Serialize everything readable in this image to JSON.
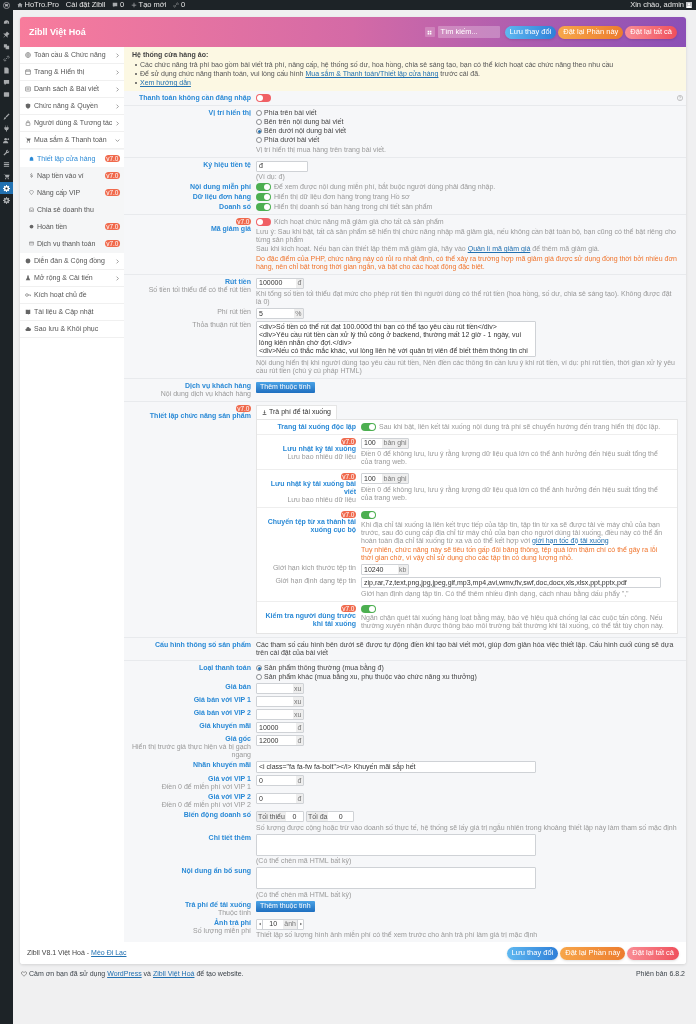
{
  "admin_bar": {
    "items": [
      {
        "kind": "logo"
      },
      {
        "kind": "home",
        "label": "HoTro.Pro"
      },
      {
        "kind": "plain",
        "label": "Cài đặt Zibll"
      },
      {
        "kind": "comments",
        "label": "0"
      },
      {
        "kind": "new",
        "label": "Tạo mới"
      },
      {
        "kind": "links",
        "label": "0"
      }
    ],
    "greeting": "Xin chào, admin"
  },
  "wp_menu": [
    {
      "selected": false
    },
    {
      "selected": false
    },
    {
      "selected": false
    },
    {
      "selected": false
    },
    {
      "selected": false
    },
    {
      "selected": false
    },
    {
      "selected": false
    },
    {
      "selected": false
    },
    {
      "selected": false
    },
    {
      "selected": false
    },
    {
      "selected": false
    },
    {
      "selected": false
    },
    {
      "selected": false
    },
    {
      "selected": true
    },
    {
      "selected": false
    }
  ],
  "header": {
    "title": "Zibll Việt Hoá",
    "search": {
      "placeholder": "Tìm kiếm..."
    },
    "buttons": [
      {
        "kind": "save",
        "label": "Lưu thay đổi"
      },
      {
        "kind": "reset_section",
        "label": "Đặt lại Phần này"
      },
      {
        "kind": "reset_all",
        "label": "Đặt lại tất cả"
      }
    ]
  },
  "sidebar": {
    "items": [
      {
        "label": "Toàn cầu & Chức năng",
        "expanded": false
      },
      {
        "label": "Trang & Hiển thị",
        "expanded": false
      },
      {
        "label": "Danh sách & Bài viết",
        "expanded": false
      },
      {
        "label": "Chức năng & Quyền",
        "expanded": false
      },
      {
        "label": "Người dùng & Tương tác",
        "expanded": false
      },
      {
        "label": "Mua sắm & Thanh toán",
        "expanded": true,
        "children": [
          {
            "label": "Thiết lập cửa hàng",
            "selected": true,
            "badge": "v7.0"
          },
          {
            "label": "Nạp tiền vào ví",
            "selected": false,
            "badge": "v7.0"
          },
          {
            "label": "Nâng cấp VIP",
            "selected": false,
            "badge": "v7.0"
          },
          {
            "label": "Chia sẻ doanh thu",
            "selected": false
          },
          {
            "label": "Hoàn tiền",
            "selected": false,
            "badge": "v7.0"
          },
          {
            "label": "Dịch vụ thanh toán",
            "selected": false,
            "badge": "v7.0"
          }
        ]
      },
      {
        "label": "Diễn đàn & Cộng đồng",
        "expanded": false
      },
      {
        "label": "Mở rộng & Cải tiến",
        "expanded": false
      },
      {
        "label": "Kích hoạt chủ đề"
      },
      {
        "label": "Tài liệu & Cập nhật"
      },
      {
        "label": "Sao lưu & Khôi phục"
      }
    ]
  },
  "notice": {
    "title": "Hệ thống cửa hàng ảo:",
    "items": [
      {
        "parts": [
          {
            "kind": "text",
            "text": "Các chức năng trả phí bao gồm bài viết trả phí, nâng cấp, hệ thống số dư, hoa hồng, chia sẻ sáng tạo, bạn có thể kích hoạt các chức năng theo nhu cầu"
          }
        ]
      },
      {
        "parts": [
          {
            "kind": "text",
            "text": "Để sử dụng chức năng thanh toán, vui lòng cấu hình "
          },
          {
            "kind": "link",
            "text": "Mua sắm & Thanh toán/Thiết lập cửa hàng"
          },
          {
            "kind": "text",
            "text": " trước cái đã."
          }
        ]
      },
      {
        "parts": [
          {
            "kind": "link",
            "text": "Xem hướng dẫn"
          }
        ]
      }
    ]
  },
  "sections": [
    {
      "rows": [
        {
          "label": "Thanh toán không cần đăng nhập",
          "items": [
            {
              "kind": "toggle",
              "on": false
            }
          ]
        }
      ]
    },
    {
      "rows": [
        {
          "label": "Vị trí hiển thị",
          "items": [
            {
              "kind": "radio_group",
              "options": [
                {
                  "label": "Phía trên bài viết",
                  "selected": false
                },
                {
                  "label": "Bên trên nội dung bài viết",
                  "selected": false
                },
                {
                  "label": "Bên dưới nội dung bài viết",
                  "selected": true
                },
                {
                  "label": "Phía dưới bài viết",
                  "selected": false
                }
              ]
            },
            {
              "kind": "hint",
              "parts": [
                {
                  "kind": "text",
                  "text": "Vị trí hiển thị mua hàng trên trang bài viết."
                }
              ]
            }
          ]
        }
      ]
    },
    {
      "rows": [
        {
          "label": "Ký hiệu tiền tệ",
          "items": [
            {
              "kind": "input",
              "value": "đ"
            },
            {
              "kind": "hint",
              "parts": [
                {
                  "kind": "text",
                  "text": "(Ví dụ: đ)"
                }
              ]
            }
          ]
        },
        {
          "label": "Nội dung miễn phí",
          "items": [
            {
              "kind": "toggle",
              "on": true,
              "text": "Để xem được nội dung miễn phí, bắt buộc người dùng phải đăng nhập."
            }
          ]
        },
        {
          "label": "Dữ liệu đơn hàng",
          "items": [
            {
              "kind": "toggle",
              "on": true,
              "text": "Hiển thị dữ liệu đơn hàng trong trang Hồ sơ"
            }
          ]
        },
        {
          "label": "Doanh số",
          "items": [
            {
              "kind": "toggle",
              "on": true,
              "text": "Hiển thị doanh số bán hàng trong chi tiết sản phẩm"
            }
          ]
        }
      ]
    },
    {
      "rows": [
        {
          "label": "Mã giảm giá",
          "badge": "v7.0",
          "items": [
            {
              "kind": "toggle",
              "on": false,
              "text": "Kích hoạt chức năng mã giảm giá cho tất cả sản phẩm"
            },
            {
              "kind": "hint",
              "parts": [
                {
                  "kind": "text",
                  "text": "Lưu ý: Sau khi bật, tất cả sản phẩm sẽ hiển thị chức năng nhập mã giảm giá, nếu không cần bật toàn bộ, bạn cũng có thể bật riêng cho từng sản phẩm"
                }
              ]
            },
            {
              "kind": "hint",
              "parts": [
                {
                  "kind": "text",
                  "text": "Sau khi kích hoạt. Nếu bạn cần thiết lập thêm mã giảm giá, hãy vào "
                },
                {
                  "kind": "link",
                  "text": "Quản lí mã giảm giá"
                },
                {
                  "kind": "text",
                  "text": " để thêm mã giảm giá."
                }
              ]
            },
            {
              "kind": "warning",
              "parts": [
                {
                  "kind": "text",
                  "text": "Do đặc điểm của PHP, chức năng này có rủi ro nhất định, có thể xảy ra trường hợp mã giảm giá được sử dụng đồng thời bởi nhiều đơn hàng, nên chỉ bật trong thời gian ngắn, và bật cho các hoạt động đặc biệt."
                }
              ]
            }
          ]
        }
      ]
    },
    {
      "rows": [
        {
          "label": "Rút tiền",
          "sublabel": "Số tiền tối thiểu để có thể rút tiền",
          "items": [
            {
              "kind": "input",
              "value": "100000",
              "unit": "đ"
            },
            {
              "kind": "hint",
              "parts": [
                {
                  "kind": "text",
                  "text": "Khi tổng số tiền tối thiểu đạt mức cho phép rút tiền thì người dùng có thể rút tiền (hoa hồng, số dư, chia sẻ sáng tạo). Không được đặt là 0)"
                }
              ]
            }
          ],
          "subfields": [
            {
              "label": "Phí rút tiền",
              "items": [
                {
                  "kind": "input",
                  "value": "5",
                  "unit": "%"
                }
              ]
            },
            {
              "label": "Thỏa thuận rút tiền",
              "items": [
                {
                  "kind": "textarea",
                  "value": "<div>Số tiền có thể rút đạt 100.000đ thì bạn có thể tạo yêu cầu rút tiền</div>\n<div>Yêu cầu rút tiền cần xử lý thủ công ở backend, thường mất 12 giờ - 1 ngày, vui lòng kiên nhẫn chờ đợi.</div>\n<div>Nếu có thắc mắc khác, vui lòng liên hệ với quản trị viên để biết thêm thông tin chi"
                },
                {
                  "kind": "hint",
                  "parts": [
                    {
                      "kind": "text",
                      "text": "Nội dung hiển thị khi người dùng tạo yêu cầu rút tiền, Nên điền các thông tin cần lưu ý khi rút tiền, ví dụ: phí rút tiền, thời gian xử lý yêu cầu rút tiền (chú ý cú pháp HTML)"
                    }
                  ]
                }
              ]
            }
          ]
        }
      ]
    },
    {
      "rows": [
        {
          "label": "Dịch vụ khách hàng",
          "sublabel": "Nội dung dịch vụ khách hàng",
          "items": [
            {
              "kind": "button",
              "label": "Thêm thuộc tính"
            }
          ]
        }
      ]
    },
    {
      "rows": [
        {
          "label": "Thiết lập chức năng sản phẩm",
          "badge": "v7.0",
          "items": [
            {
              "kind": "tabs",
              "tabs": [
                {
                  "label": "Trả phí để tải xuống",
                  "selected": true
                }
              ],
              "groups": [
                {
                  "rows": [
                    {
                      "label": "Trang tải xuống độc lập",
                      "items": [
                        {
                          "kind": "toggle",
                          "on": true,
                          "text": "Sau khi bật, liên kết tải xuống nội dung trả phí sẽ chuyển hướng đến trang hiển thị độc lập."
                        }
                      ]
                    }
                  ]
                },
                {
                  "rows": [
                    {
                      "label": "Lưu nhật ký tải xuống",
                      "badge": "v7.0",
                      "sublabel": "Lưu bao nhiêu dữ liệu",
                      "items": [
                        {
                          "kind": "input",
                          "value": "100",
                          "unit": "bản ghi"
                        },
                        {
                          "kind": "hint",
                          "parts": [
                            {
                              "kind": "text",
                              "text": "Điền 0 để không lưu, lưu ý rằng lượng dữ liệu quá lớn có thể ảnh hưởng đến hiệu suất tổng thể của trang web."
                            }
                          ]
                        }
                      ]
                    }
                  ]
                },
                {
                  "rows": [
                    {
                      "label": "Lưu nhật ký tải xuống bài viết",
                      "badge": "v7.0",
                      "sublabel": "Lưu bao nhiêu dữ liệu",
                      "items": [
                        {
                          "kind": "input",
                          "value": "100",
                          "unit": "bản ghi"
                        },
                        {
                          "kind": "hint",
                          "parts": [
                            {
                              "kind": "text",
                              "text": "Điền 0 để không lưu, lưu ý rằng lượng dữ liệu quá lớn có thể ảnh hưởng đến hiệu suất tổng thể của trang web."
                            }
                          ]
                        }
                      ]
                    }
                  ]
                },
                {
                  "rows": [
                    {
                      "label": "Chuyển tệp từ xa thành tải xuống cục bộ",
                      "badge": "v7.0",
                      "items": [
                        {
                          "kind": "toggle",
                          "on": true
                        },
                        {
                          "kind": "hint",
                          "parts": [
                            {
                              "kind": "text",
                              "text": "Khi địa chỉ tải xuống là liên kết trực tiếp của tập tin, tập tin từ xa sẽ được tải về máy chủ của bạn trước, sau đó cung cấp địa chỉ từ máy chủ của bạn cho người dùng tải xuống, điều này có thể ẩn hoàn toàn địa chỉ tải xuống từ xa và có thể kết hợp với "
                            },
                            {
                              "kind": "link",
                              "text": "giới hạn tốc độ tải xuống"
                            }
                          ]
                        },
                        {
                          "kind": "warning",
                          "parts": [
                            {
                              "kind": "text",
                              "text": "Tuy nhiên, chức năng này sẽ tiêu tốn gấp đôi băng thông, tệp quá lớn thậm chí có thể gây ra lỗi thời gian chờ, vì vậy chỉ sử dụng cho các tập tin có dung lượng nhỏ."
                            }
                          ]
                        }
                      ],
                      "subfields": [
                        {
                          "label": "Giới hạn kích thước tệp tin",
                          "items": [
                            {
                              "kind": "input",
                              "value": "10240",
                              "unit": "kb"
                            }
                          ]
                        },
                        {
                          "label": "Giới hạn định dạng tệp tin",
                          "items": [
                            {
                              "kind": "wide_input",
                              "value": "zip,rar,7z,text,png,jpg,jpeg,gif,mp3,mp4,avi,wmv,flv,swf,doc,docx,xls,xlsx,ppt,pptx,pdf"
                            },
                            {
                              "kind": "hint",
                              "parts": [
                                {
                                  "kind": "text",
                                  "text": "Giới hạn định dạng tập tin. Có thể thêm nhiều định dạng, cách nhau bằng dấu phẩy \",\""
                                }
                              ]
                            }
                          ]
                        }
                      ]
                    }
                  ]
                },
                {
                  "rows": [
                    {
                      "label": "Kiểm tra người dùng trước khi tải xuống",
                      "badge": "v7.0",
                      "items": [
                        {
                          "kind": "toggle",
                          "on": true
                        },
                        {
                          "kind": "hint",
                          "parts": [
                            {
                              "kind": "text",
                              "text": "Ngăn chặn quét tải xuống hàng loạt bằng máy, bảo vệ hiệu quả chống lại các cuộc tấn công. Nếu thường xuyên nhận được thông báo môi trường bất thường khi tải xuống, có thể tắt tùy chọn này."
                            }
                          ]
                        }
                      ]
                    }
                  ]
                }
              ]
            }
          ]
        }
      ]
    },
    {
      "rows": [
        {
          "label": "Cấu hình thông số sản phẩm",
          "items": [
            {
              "kind": "description",
              "parts": [
                {
                  "kind": "text",
                  "text": "Các tham số cấu hình bên dưới sẽ được tự động điền khi tạo bài viết mới, giúp đơn giản hóa việc thiết lập. Cấu hình cuối cùng sẽ dựa trên cài đặt của bài viết"
                }
              ]
            }
          ]
        }
      ]
    },
    {
      "rows": [
        {
          "label": "Loại thanh toán",
          "items": [
            {
              "kind": "radio_group",
              "options": [
                {
                  "label": "Sản phẩm thông thường (mua bằng đ)",
                  "selected": true
                },
                {
                  "label": "Sản phẩm khác (mua bằng xu, phụ thuộc vào chức năng xu thưởng)",
                  "selected": false
                }
              ]
            }
          ]
        },
        {
          "label": "Giá bán",
          "items": [
            {
              "kind": "input",
              "unit": "xu"
            }
          ]
        },
        {
          "label": "Giá bán với VIP 1",
          "items": [
            {
              "kind": "input",
              "unit": "xu"
            }
          ]
        },
        {
          "label": "Giá bán với VIP 2",
          "items": [
            {
              "kind": "input",
              "unit": "xu"
            }
          ]
        },
        {
          "label": "Giá khuyến mãi",
          "items": [
            {
              "kind": "input",
              "value": "10000",
              "unit": "đ"
            }
          ]
        },
        {
          "label": "Giá gốc",
          "sublabel": "Hiển thị trước giá thực hiện và bị gạch ngang",
          "items": [
            {
              "kind": "input",
              "value": "12000",
              "unit": "đ"
            }
          ]
        },
        {
          "label": "Nhãn khuyến mãi",
          "items": [
            {
              "kind": "textarea",
              "value": "<i class=\"fa fa-fw fa-bolt\"></i> Khuyến mãi sắp hết"
            }
          ]
        },
        {
          "label": "Giá với VIP 1",
          "sublabel": "Điền 0 để miễn phí với VIP 1",
          "items": [
            {
              "kind": "input",
              "value": "0",
              "unit": "đ"
            }
          ]
        },
        {
          "label": "Giá với VIP 2",
          "sublabel": "Điền 0 để miễn phí với VIP 2",
          "items": [
            {
              "kind": "input",
              "value": "0",
              "unit": "đ"
            }
          ]
        },
        {
          "label": "Biến động doanh số",
          "items": [
            {
              "kind": "range",
              "fields": [
                {
                  "prefix": "Tối thiểu",
                  "value": "0"
                },
                {
                  "prefix": "Tối đa",
                  "value": "0"
                }
              ]
            },
            {
              "kind": "hint",
              "parts": [
                {
                  "kind": "text",
                  "text": "Số lượng được cộng hoặc trừ vào doanh số thực tế, hệ thống sẽ lấy giá trị ngẫu nhiên trong khoảng thiết lập này làm tham số mặc định"
                }
              ]
            }
          ]
        },
        {
          "label": "Chi tiết thêm",
          "items": [
            {
              "kind": "textarea"
            },
            {
              "kind": "hint",
              "parts": [
                {
                  "kind": "text",
                  "text": "(Có thể chèn mã HTML bất kỳ)"
                }
              ]
            }
          ]
        },
        {
          "label": "Nội dung ẩn bổ sung",
          "items": [
            {
              "kind": "textarea"
            },
            {
              "kind": "hint",
              "parts": [
                {
                  "kind": "text",
                  "text": "(Có thể chèn mã HTML bất kỳ)"
                }
              ]
            }
          ]
        },
        {
          "label": "Trả phí để tải xuống",
          "sublabel": "Thuộc tính",
          "items": [
            {
              "kind": "button",
              "label": "Thêm thuộc tính"
            }
          ]
        },
        {
          "label": "Ảnh trả phí",
          "sublabel": "Số lượng miễn phí",
          "items": [
            {
              "kind": "stepper",
              "value": "10",
              "unit": "ảnh"
            },
            {
              "kind": "hint",
              "parts": [
                {
                  "kind": "text",
                  "text": "Thiết lập số lượng hình ảnh miễn phí có thể xem trước cho ảnh trả phí làm giá trị mặc định"
                }
              ]
            }
          ]
        }
      ]
    }
  ],
  "footer": {
    "parts": [
      {
        "kind": "text",
        "text": "Zibll V8.1 Việt Hoá - "
      },
      {
        "kind": "link",
        "text": "Mèo Đi Lạc"
      }
    ],
    "buttons": [
      {
        "kind": "save",
        "label": "Lưu thay đổi"
      },
      {
        "kind": "reset_section",
        "label": "Đặt lại Phần này"
      },
      {
        "kind": "reset_all",
        "label": "Đặt lại tất cả"
      }
    ]
  },
  "page_footer": {
    "parts": [
      {
        "kind": "text",
        "text": "Cảm ơn bạn đã sử dụng "
      },
      {
        "kind": "link",
        "text": "WordPress"
      },
      {
        "kind": "text",
        "text": " và "
      },
      {
        "kind": "link",
        "text": "Zibll Việt Hoá"
      },
      {
        "kind": "text",
        "text": " để tạo website."
      }
    ],
    "version": "Phiên bản 6.8.2"
  }
}
